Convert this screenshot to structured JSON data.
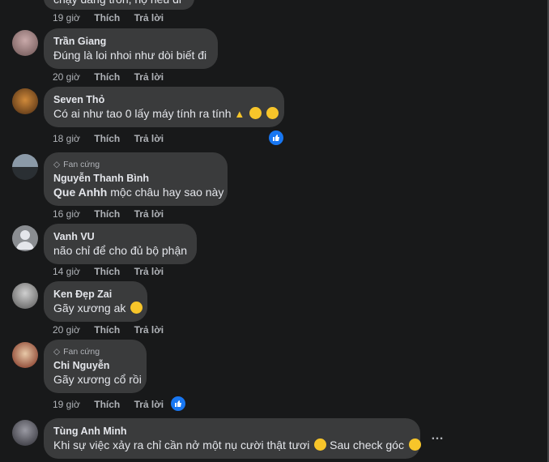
{
  "labels": {
    "like": "Thích",
    "reply": "Trả lời"
  },
  "top": {
    "text": "chạy đang trốn, nọ nếu đi",
    "time": "19 giờ"
  },
  "comments": [
    {
      "author": "Trần Giang",
      "text": "Đúng là loi nhoi như dòi biết đi",
      "time": "20 giờ"
    },
    {
      "author": "Seven Thỏ",
      "text": "Có ai như tao 0 lấy máy tính ra tính",
      "time": "18 giờ"
    },
    {
      "badge": "Fan cứng",
      "author": "Nguyễn Thanh Bình",
      "mention": "Que Anhh",
      "text": " mộc châu hay sao này",
      "time": "16 giờ"
    },
    {
      "author": "Vanh VU",
      "text": "não chỉ để cho đủ bộ phận",
      "time": "14 giờ"
    },
    {
      "author": "Ken Đẹp Zai",
      "text": "Gãy xương ak",
      "time": "20 giờ"
    },
    {
      "badge": "Fan cứng",
      "author": "Chi Nguyễn",
      "text": "Gãy xương cổ rồi",
      "time": "19 giờ"
    },
    {
      "author": "Tùng Anh Minh",
      "text": "Khi sự việc xảy ra chỉ cần nở một nụ cười thật tươi",
      "text2": " Sau check góc",
      "more": "…"
    }
  ]
}
